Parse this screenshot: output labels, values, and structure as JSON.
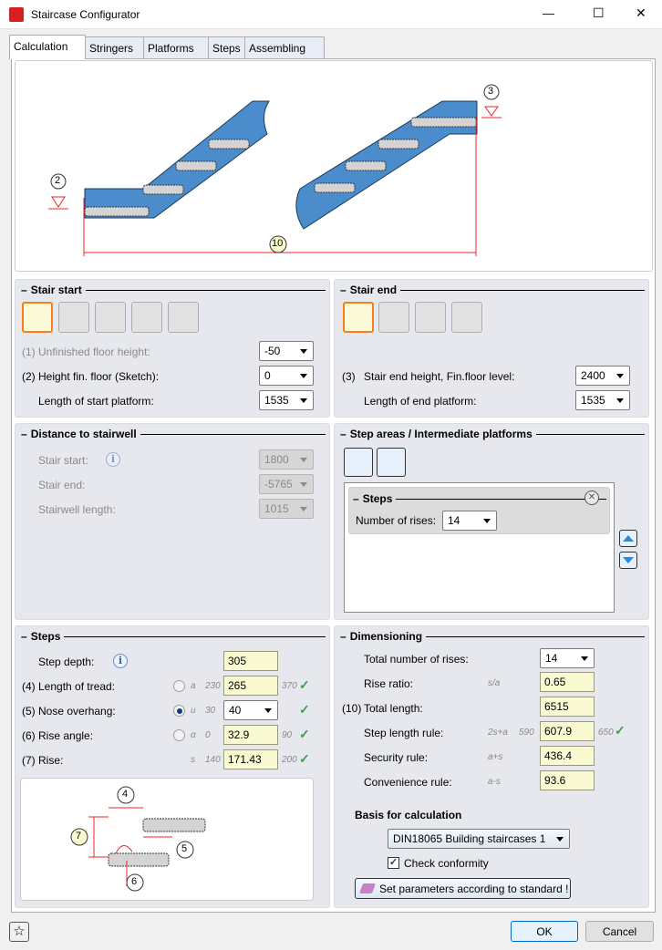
{
  "window": {
    "title": "Staircase Configurator",
    "minimize": "—",
    "maximize": "☐",
    "close": "✕"
  },
  "tabs": [
    "Calculation",
    "Stringers",
    "Platforms",
    "Steps",
    "Assembling"
  ],
  "sketch": {
    "marker_start": "2",
    "marker_end": "3",
    "marker_length": "10"
  },
  "stair_start": {
    "title": "Stair start",
    "unfinished_floor_label": "(1) Unfinished floor height:",
    "unfinished_floor_value": "-50",
    "height_fin_label": "(2) Height fin. floor  (Sketch):",
    "height_fin_value": "0",
    "start_platform_label": "Length of start platform:",
    "start_platform_value": "1535"
  },
  "stair_end": {
    "title": "Stair end",
    "end_height_num": "(3)",
    "end_height_label": "Stair end height, Fin.floor level:",
    "end_height_value": "2400",
    "end_platform_label": "Length of end platform:",
    "end_platform_value": "1535"
  },
  "distance": {
    "title": "Distance to stairwell",
    "start_label": "Stair start:",
    "start_value": "1800",
    "end_label": "Stair end:",
    "end_value": "-5765",
    "length_label": "Stairwell length:",
    "length_value": "1015"
  },
  "step_areas": {
    "title": "Step areas / Intermediate platforms",
    "group_title": "Steps",
    "rises_label": "Number of rises:",
    "rises_value": "14"
  },
  "steps": {
    "title": "Steps",
    "depth_label": "Step depth:",
    "depth_value": "305",
    "tread_label": "(4) Length of tread:",
    "tread_sym": "a",
    "tread_min": "230",
    "tread_value": "265",
    "tread_max": "370",
    "nose_label": "(5) Nose overhang:",
    "nose_sym": "u",
    "nose_min": "30",
    "nose_value": "40",
    "angle_label": "(6) Rise angle:",
    "angle_sym": "α",
    "angle_min": "0",
    "angle_value": "32.9",
    "angle_max": "90",
    "rise_label": "(7) Rise:",
    "rise_sym": "s",
    "rise_min": "140",
    "rise_value": "171.43",
    "rise_max": "200",
    "diagram": {
      "n4": "4",
      "n5": "5",
      "n6": "6",
      "n7": "7"
    }
  },
  "dimensioning": {
    "title": "Dimensioning",
    "total_rises_label": "Total number of rises:",
    "total_rises_value": "14",
    "rise_ratio_label": "Rise ratio:",
    "rise_ratio_sym": "s/a",
    "rise_ratio_value": "0.65",
    "total_length_num": "(10)",
    "total_length_label": "Total length:",
    "total_length_value": "6515",
    "step_rule_label": "Step length rule:",
    "step_rule_sym": "2s+a",
    "step_rule_min": "590",
    "step_rule_value": "607.9",
    "step_rule_max": "650",
    "security_label": "Security rule:",
    "security_sym": "a+s",
    "security_value": "436.4",
    "convenience_label": "Convenience rule:",
    "convenience_sym": "a-s",
    "convenience_value": "93.6",
    "basis_title": "Basis for calculation",
    "basis_value": "DIN18065 Building staircases 1",
    "check_label": "Check conformity",
    "set_params_label": "Set parameters according to standard !"
  },
  "footer": {
    "ok": "OK",
    "cancel": "Cancel"
  },
  "colors": {
    "accent": "#ff7a1a",
    "steel": "#4a8ccc",
    "field": "#fafad2",
    "dim": "#e8252a"
  }
}
